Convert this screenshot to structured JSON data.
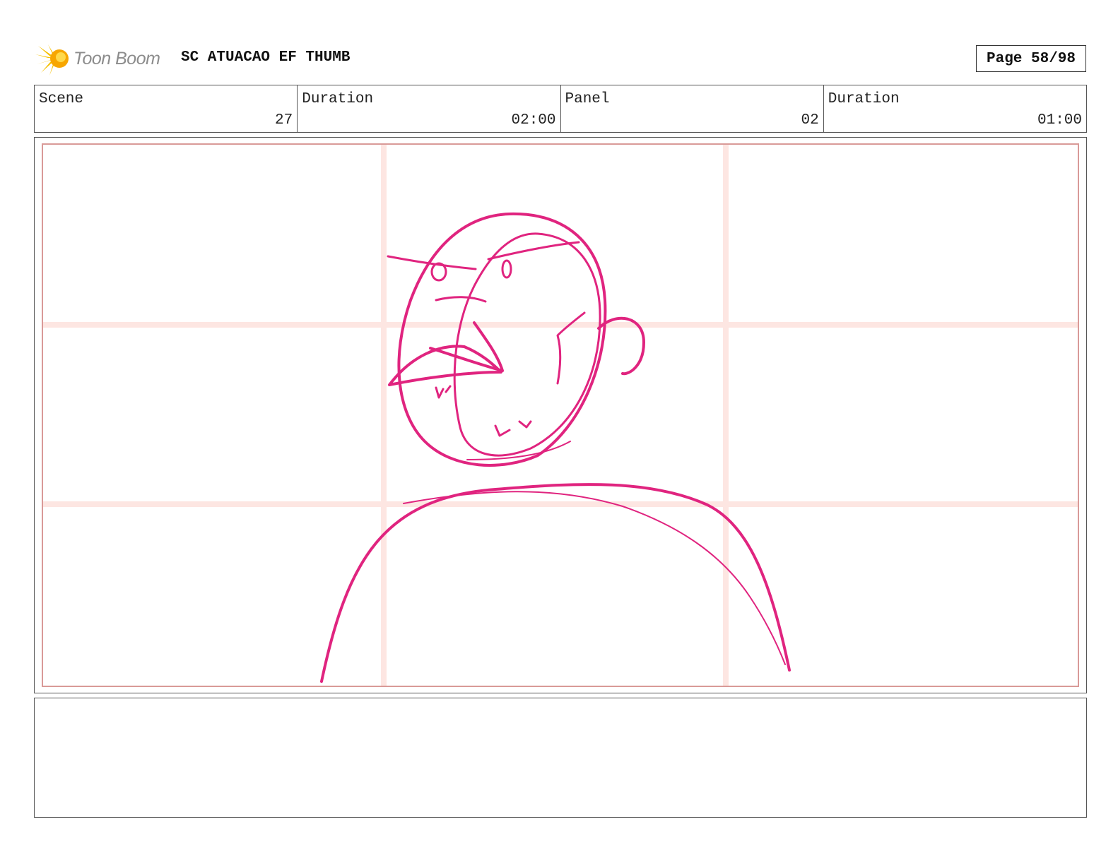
{
  "header": {
    "logo_text": "Toon Boom",
    "title": "SC ATUACAO EF THUMB",
    "page_label": "Page 58/98"
  },
  "info": [
    {
      "label": "Scene",
      "value": "27"
    },
    {
      "label": "Duration",
      "value": "02:00"
    },
    {
      "label": "Panel",
      "value": "02"
    },
    {
      "label": "Duration",
      "value": "01:00"
    }
  ],
  "panel": {
    "sketch_color": "#e0247f",
    "grid_color": "#fde6e2",
    "frame_color": "#d99a98"
  },
  "icons": {
    "logo": "toon-boom-burst-icon"
  },
  "notes": {
    "text": ""
  }
}
